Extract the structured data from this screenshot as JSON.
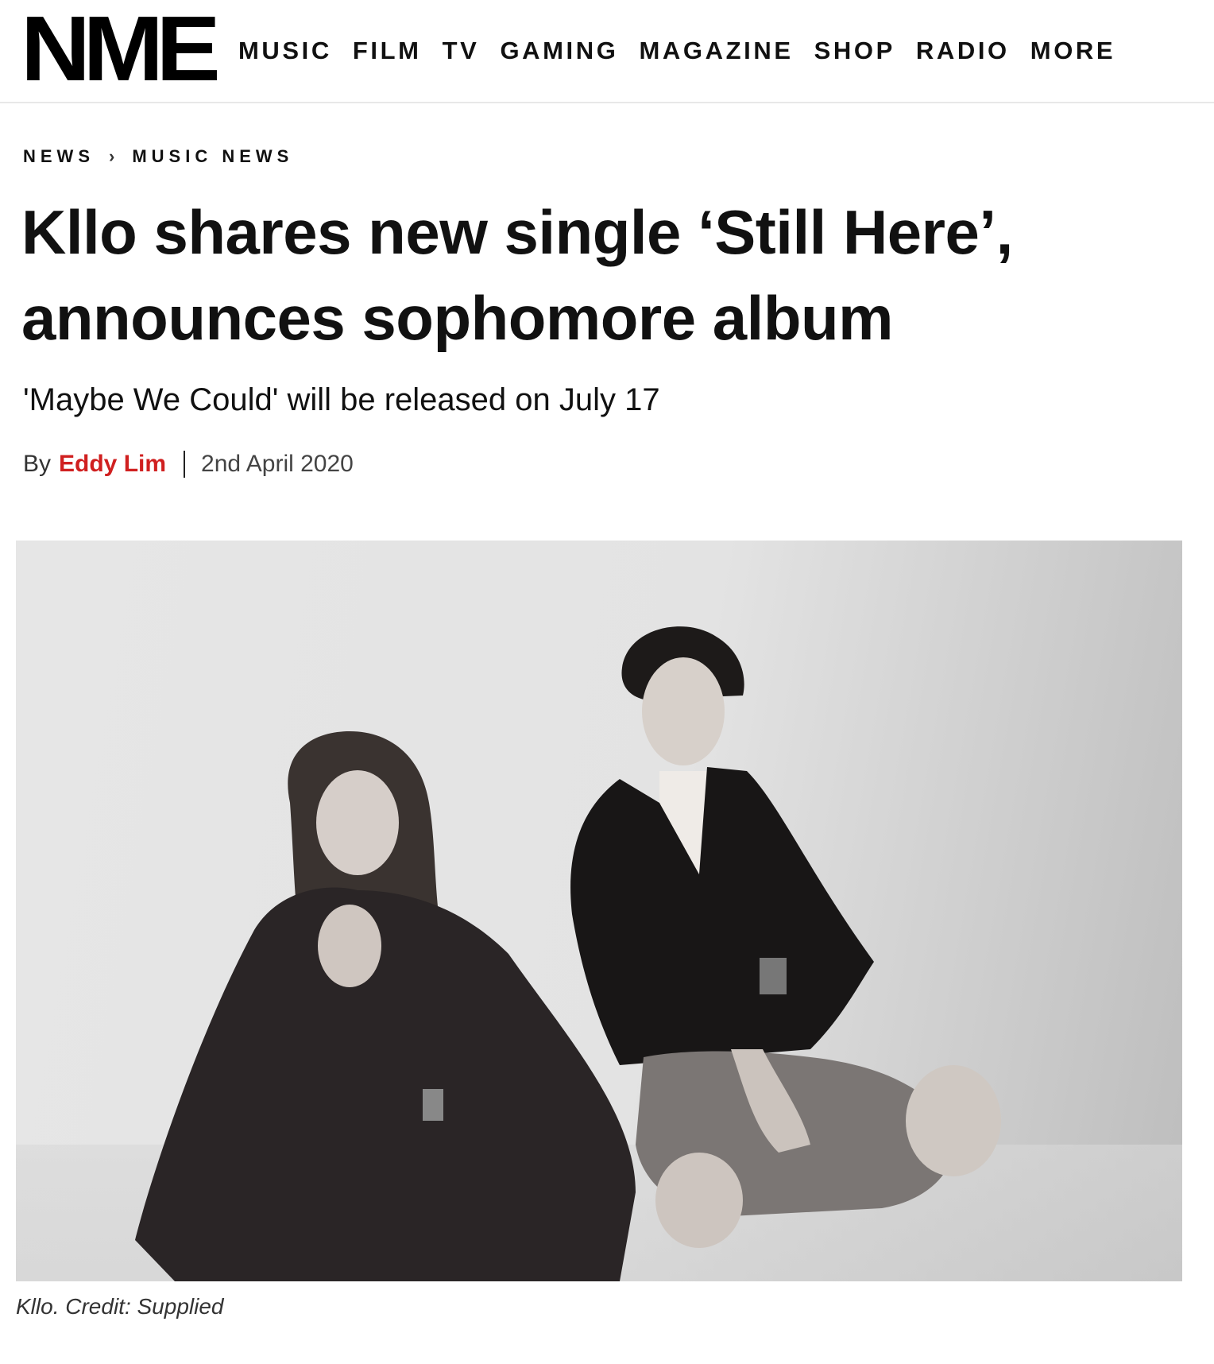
{
  "header": {
    "logo_text": "NME",
    "nav": [
      "MUSIC",
      "FILM",
      "TV",
      "GAMING",
      "MAGAZINE",
      "SHOP",
      "RADIO",
      "MORE"
    ]
  },
  "breadcrumb": {
    "items": [
      "NEWS",
      "MUSIC NEWS"
    ],
    "separator": "›"
  },
  "article": {
    "headline_line1": "Kllo shares new single ‘Still Here’,",
    "headline_line2": "announces sophomore album",
    "subheading": "'Maybe We Could' will be released on July 17",
    "byline_prefix": "By",
    "author": "Eddy Lim",
    "date": "2nd April 2020",
    "image_caption": "Kllo. Credit: Supplied"
  },
  "colors": {
    "accent": "#d02020",
    "text": "#111111"
  }
}
